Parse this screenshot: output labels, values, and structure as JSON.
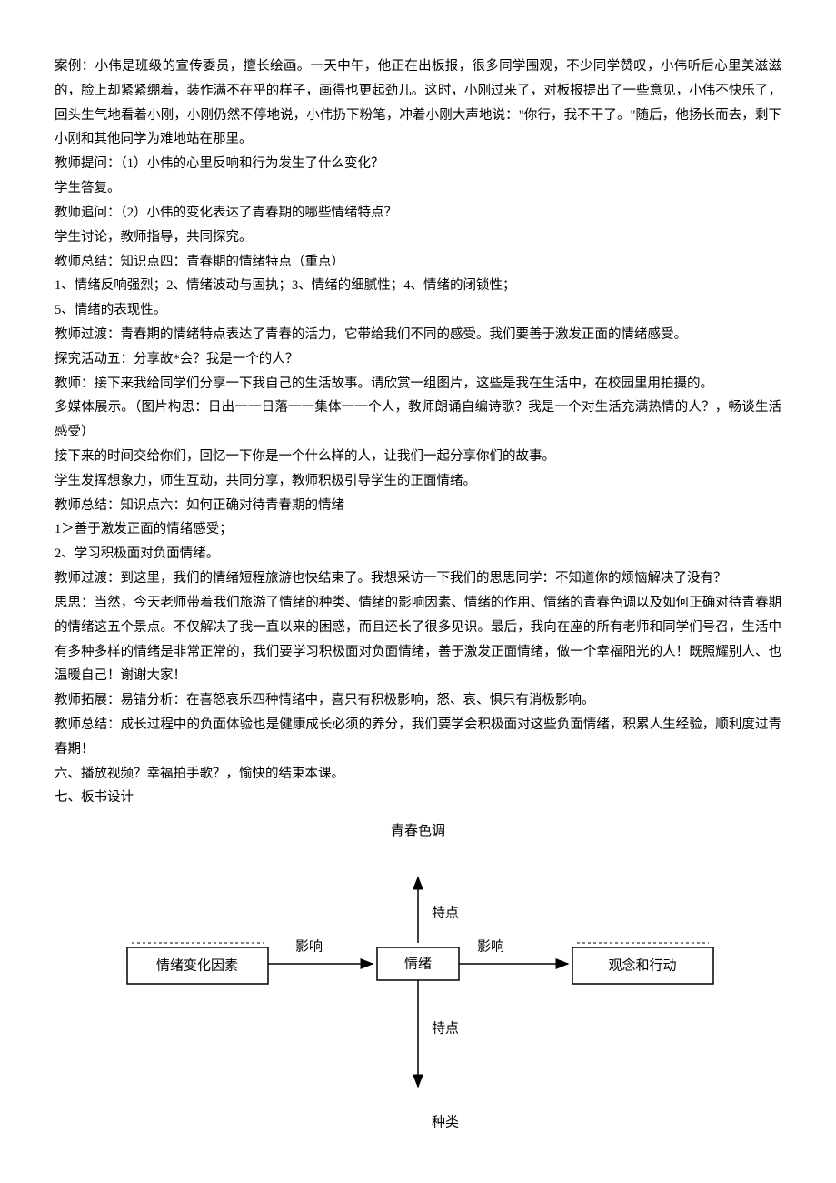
{
  "paragraphs": [
    "案例：小伟是班级的宣传委员，擅长绘画。一天中午，他正在出板报，很多同学围观，不少同学赞叹，小伟听后心里美滋滋的，脸上却紧紧绷着，装作满不在乎的样子，画得也更起劲儿。这时，小刚过来了，对板报提出了一些意见，小伟不快乐了，回头生气地看着小刚，小刚仍然不停地说，小伟扔下粉笔，冲着小刚大声地说：\"你行，我不干了。\"随后，他扬长而去，剩下小刚和其他同学为难地站在那里。",
    "教师提问：（1）小伟的心里反响和行为发生了什么变化？",
    "学生答复。",
    "教师追问：（2）小伟的变化表达了青春期的哪些情绪特点？",
    "学生讨论，教师指导，共同探究。",
    "教师总结：知识点四：青春期的情绪特点（重点）",
    "1、情绪反响强烈；2、情绪波动与固执；3、情绪的细腻性；4、情绪的闭锁性；",
    "5、情绪的表现性。",
    "教师过渡：青春期的情绪特点表达了青春的活力，它带给我们不同的感受。我们要善于激发正面的情绪感受。",
    "探究活动五：分享故*会？我是一个的人？",
    "教师：接下来我给同学们分享一下我自己的生活故事。请欣赏一组图片，这些是我在生活中，在校园里用拍摄的。",
    "多媒体展示。（图片构思：日出一一日落一一集体一一个人，教师朗诵自编诗歌？我是一个对生活充满热情的人？，畅谈生活感受）",
    "接下来的时间交给你们，回忆一下你是一个什么样的人，让我们一起分享你们的故事。",
    "学生发挥想象力，师生互动，共同分享，教师积极引导学生的正面情绪。",
    "教师总结：知识点六：如何正确对待青春期的情绪",
    "1＞善于激发正面的情绪感受；",
    "2、学习积极面对负面情绪。",
    "教师过渡：到这里，我们的情绪短程旅游也快结束了。我想采访一下我们的思思同学：不知道你的烦恼解决了没有？",
    "思思：当然，今天老师带着我们旅游了情绪的种类、情绪的影响因素、情绪的作用、情绪的青春色调以及如何正确对待青春期的情绪这五个景点。不仅解决了我一直以来的困惑，而且还长了很多见识。最后，我向在座的所有老师和同学们号召，生活中有多种多样的情绪是非常正常的，我们要学习积极面对负面情绪，善于激发正面情绪，做一个幸福阳光的人！既照耀别人、也温暖自己！谢谢大家！",
    "教师拓展：易错分析：在喜怒哀乐四种情绪中，喜只有积极影响，怒、哀、惧只有消极影响。",
    "教师总结：成长过程中的负面体验也是健康成长必须的养分，我们要学会积极面对这些负面情绪，积累人生经验，顺利度过青春期！",
    "六、播放视频？幸福拍手歌？，愉快的结束本课。",
    "七、板书设计"
  ],
  "diagram": {
    "title": "青春色调",
    "center": "情绪",
    "left_box": "情绪变化因素",
    "right_box": "观念和行动",
    "top_label": "特点",
    "bottom_label": "特点",
    "left_arrow_label": "影响",
    "right_arrow_label": "影响",
    "bottom_word": "种类"
  }
}
